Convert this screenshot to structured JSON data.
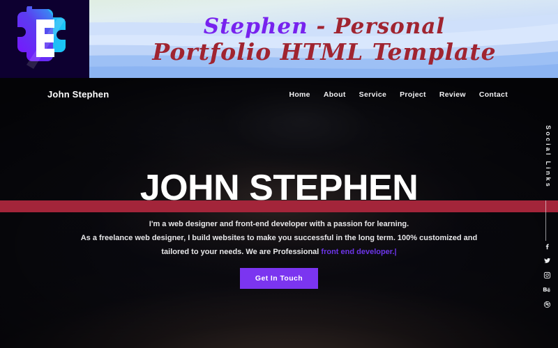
{
  "banner": {
    "logo_icon": "puzzle-c-logo-icon",
    "logo_colors": {
      "navy": "#0d0030",
      "purple": "#7722ee",
      "cyan": "#22c6f0"
    },
    "title_line1_part1": "Stephen",
    "title_line1_part2": " - Personal",
    "title_line2": "Portfolio HTML Template",
    "accent_purple": "#7722ee",
    "accent_red": "#a02430"
  },
  "nav": {
    "brand": "John Stephen",
    "items": [
      {
        "label": "Home"
      },
      {
        "label": "About"
      },
      {
        "label": "Service"
      },
      {
        "label": "Project"
      },
      {
        "label": "Review"
      },
      {
        "label": "Contact"
      }
    ]
  },
  "hero": {
    "title": "JOHN STEPHEN",
    "band_color": "#a3253a",
    "paragraph_line1": "I'm a web designer and front-end developer with a passion for learning.",
    "paragraph_line2": "As a freelance web designer, I build websites to make you successful in the long term. 100% customized and",
    "paragraph_line3_static": "tailored to your needs. We are Professional ",
    "paragraph_line3_typed": "front end developer.",
    "typed_caret": "|",
    "typed_color": "#6c35e8",
    "cta_label": "Get In Touch",
    "cta_color": "#7b35f0"
  },
  "social": {
    "label": "Social Links",
    "items": [
      {
        "name": "facebook-icon"
      },
      {
        "name": "twitter-icon"
      },
      {
        "name": "instagram-icon"
      },
      {
        "name": "behance-icon"
      },
      {
        "name": "dribbble-icon"
      }
    ]
  }
}
